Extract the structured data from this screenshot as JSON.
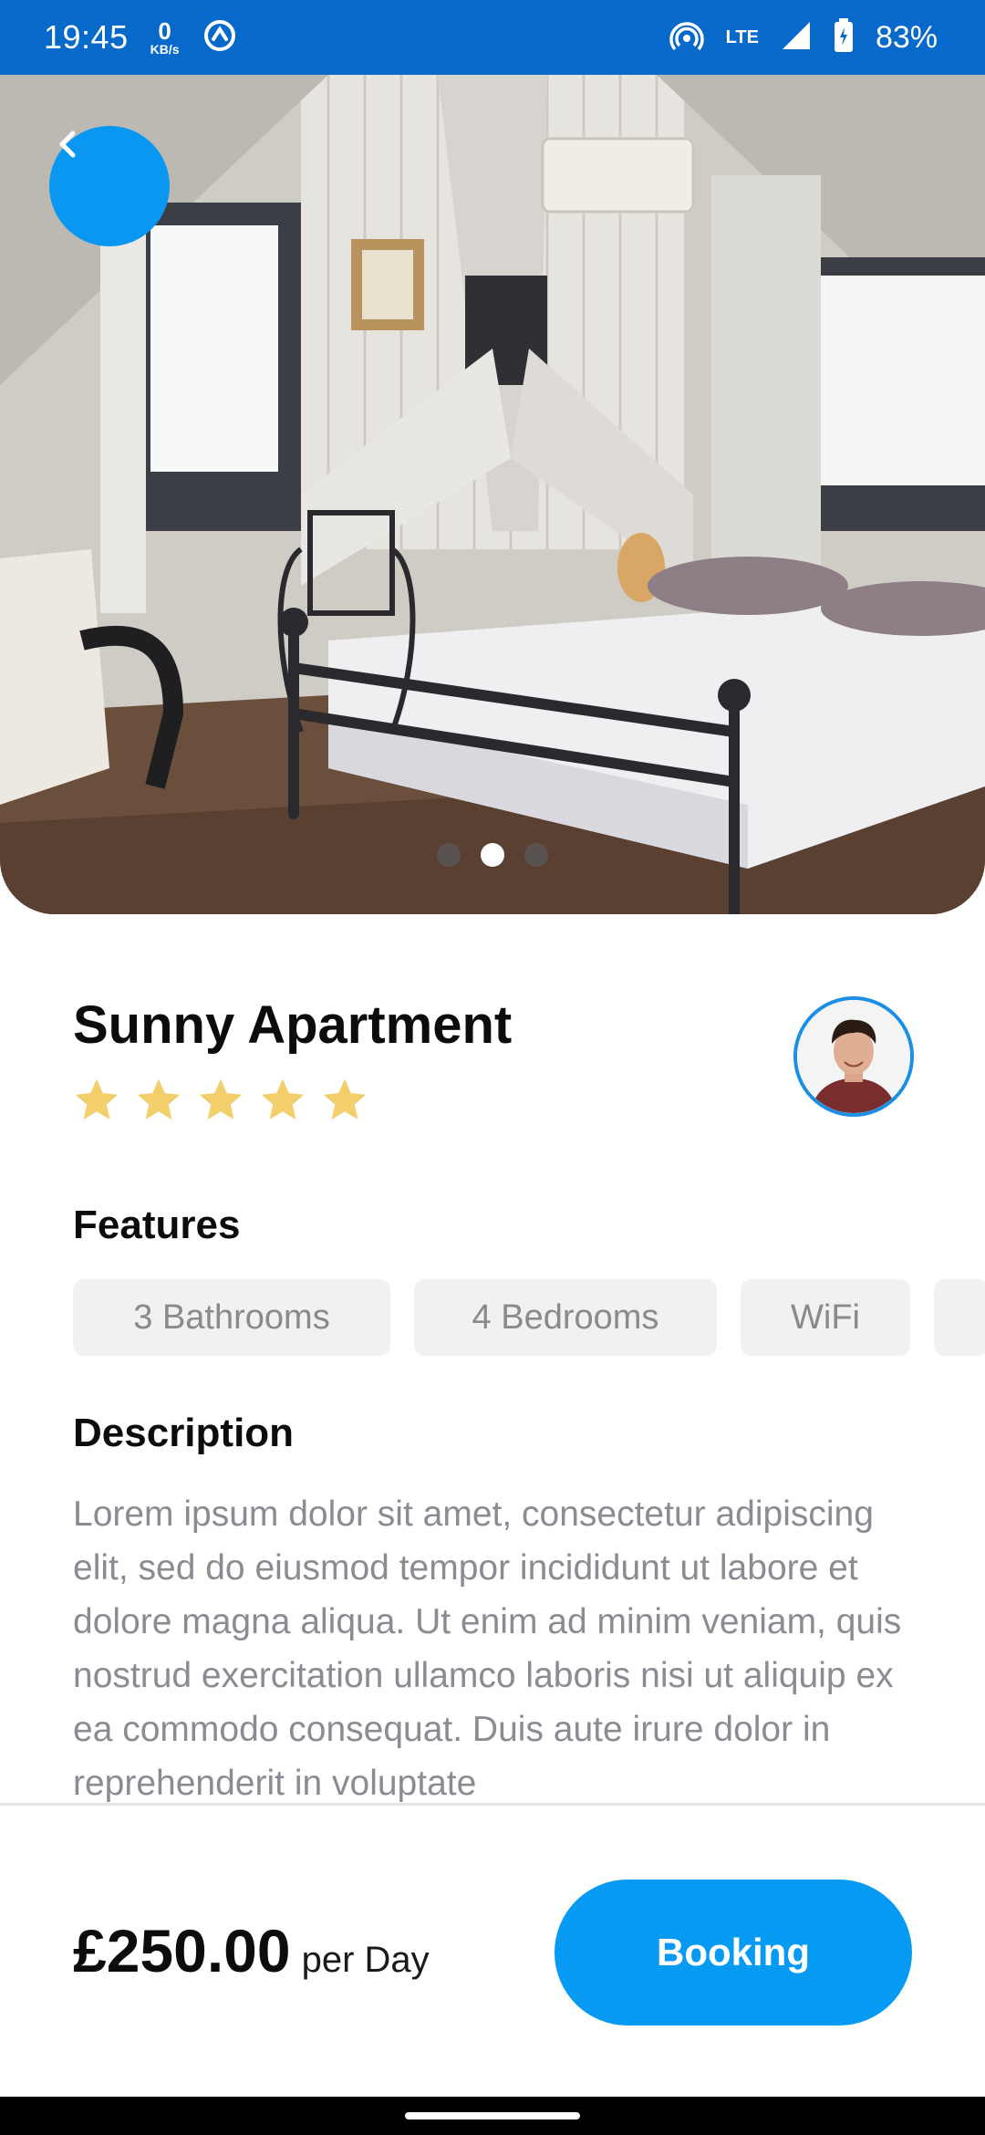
{
  "status_bar": {
    "time": "19:45",
    "net_speed": "0",
    "net_unit": "KB/s",
    "network": "LTE",
    "battery": "83%"
  },
  "hero": {
    "icons": {
      "back": "chevron-left-icon"
    },
    "carousel": {
      "count": 3,
      "active_index": 1
    }
  },
  "listing": {
    "title": "Sunny Apartment",
    "rating": 5,
    "rating_max": 5
  },
  "features": {
    "heading": "Features",
    "items": [
      "3 Bathrooms",
      "4 Bedrooms",
      "WiFi",
      ""
    ]
  },
  "description": {
    "heading": "Description",
    "text": "Lorem ipsum dolor sit amet, consectetur adipiscing elit, sed do eiusmod tempor incididunt ut labore et dolore magna aliqua. Ut enim ad minim veniam, quis nostrud exercitation ullamco laboris nisi ut aliquip ex ea commodo consequat. Duis aute irure dolor in reprehenderit in voluptate"
  },
  "footer": {
    "price": "£250.00",
    "price_unit": "per Day",
    "booking_label": "Booking"
  },
  "colors": {
    "status_bar": "#0769c9",
    "accent": "#069af3",
    "star": "#f3cf6b",
    "chip_bg": "#f1f1f1",
    "muted_text": "#8b8b93"
  }
}
